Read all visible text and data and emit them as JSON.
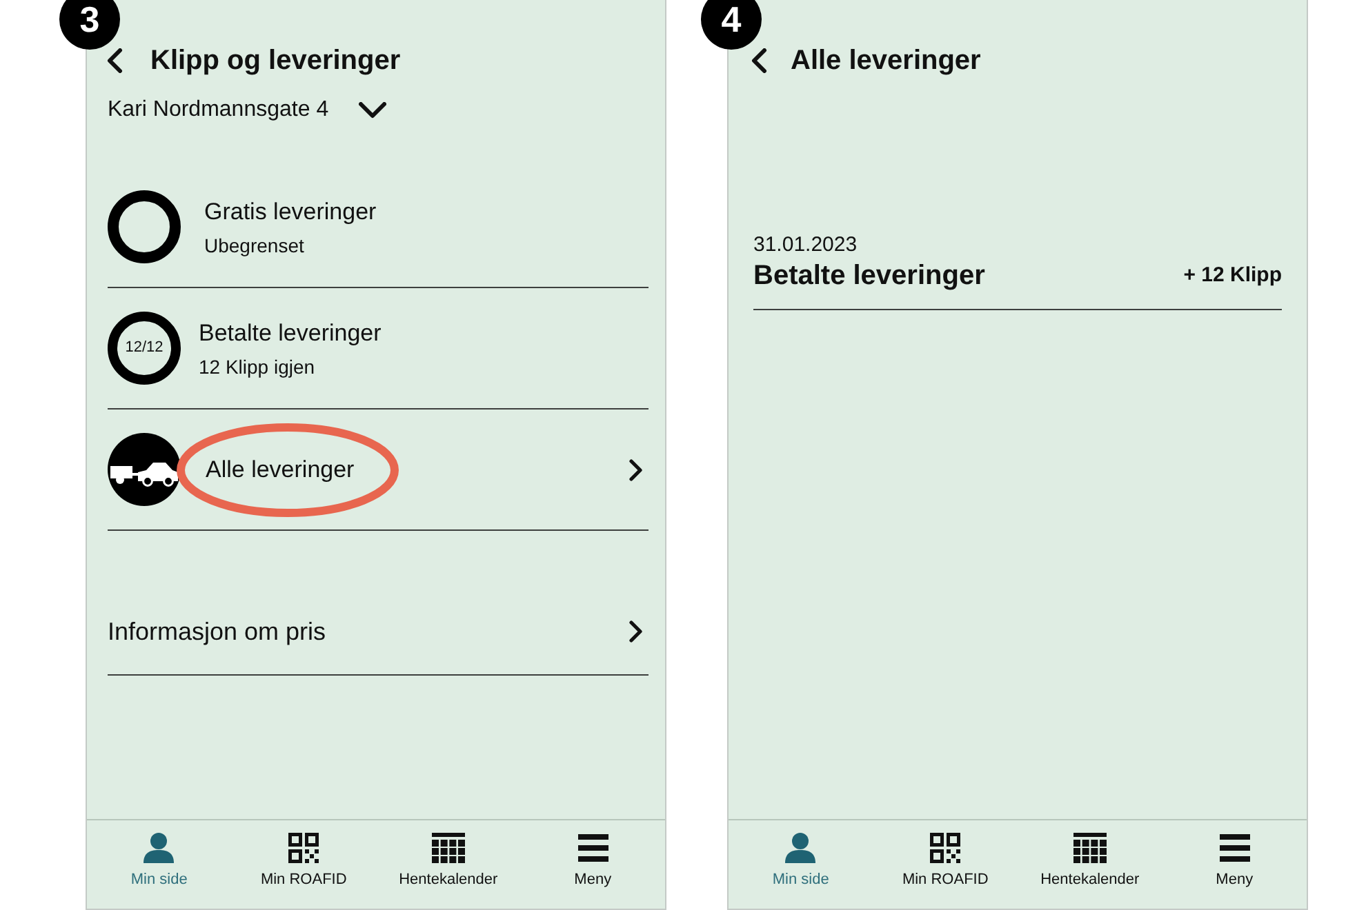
{
  "screens": [
    {
      "step": "3",
      "header": {
        "title": "Klipp og leveringer"
      },
      "address_picker": {
        "value": "Kari Nordmannsgate 4"
      },
      "rows": [
        {
          "kind": "ring",
          "title": "Gratis leveringer",
          "subtitle": "Ubegrenset",
          "highlighted": false
        },
        {
          "kind": "counter",
          "counter": "12/12",
          "title": "Betalte leveringer",
          "subtitle": "12 Klipp igjen",
          "highlighted": false
        },
        {
          "kind": "icon-link",
          "title": "Alle leveringer",
          "highlighted": true
        },
        {
          "kind": "link",
          "title": "Informasjon om pris",
          "highlighted": false
        }
      ],
      "tab_bar": [
        {
          "label": "Min side",
          "selected": true
        },
        {
          "label": "Min ROAFID",
          "selected": false
        },
        {
          "label": "Hentekalender",
          "selected": false
        },
        {
          "label": "Meny",
          "selected": false
        }
      ]
    },
    {
      "step": "4",
      "header": {
        "title": "Alle leveringer"
      },
      "entries": [
        {
          "date": "31.01.2023",
          "title": "Betalte leveringer",
          "amount": "+ 12 Klipp"
        }
      ],
      "tab_bar": [
        {
          "label": "Min side",
          "selected": true
        },
        {
          "label": "Min ROAFID",
          "selected": false
        },
        {
          "label": "Hentekalender",
          "selected": false
        },
        {
          "label": "Meny",
          "selected": false
        }
      ]
    }
  ]
}
